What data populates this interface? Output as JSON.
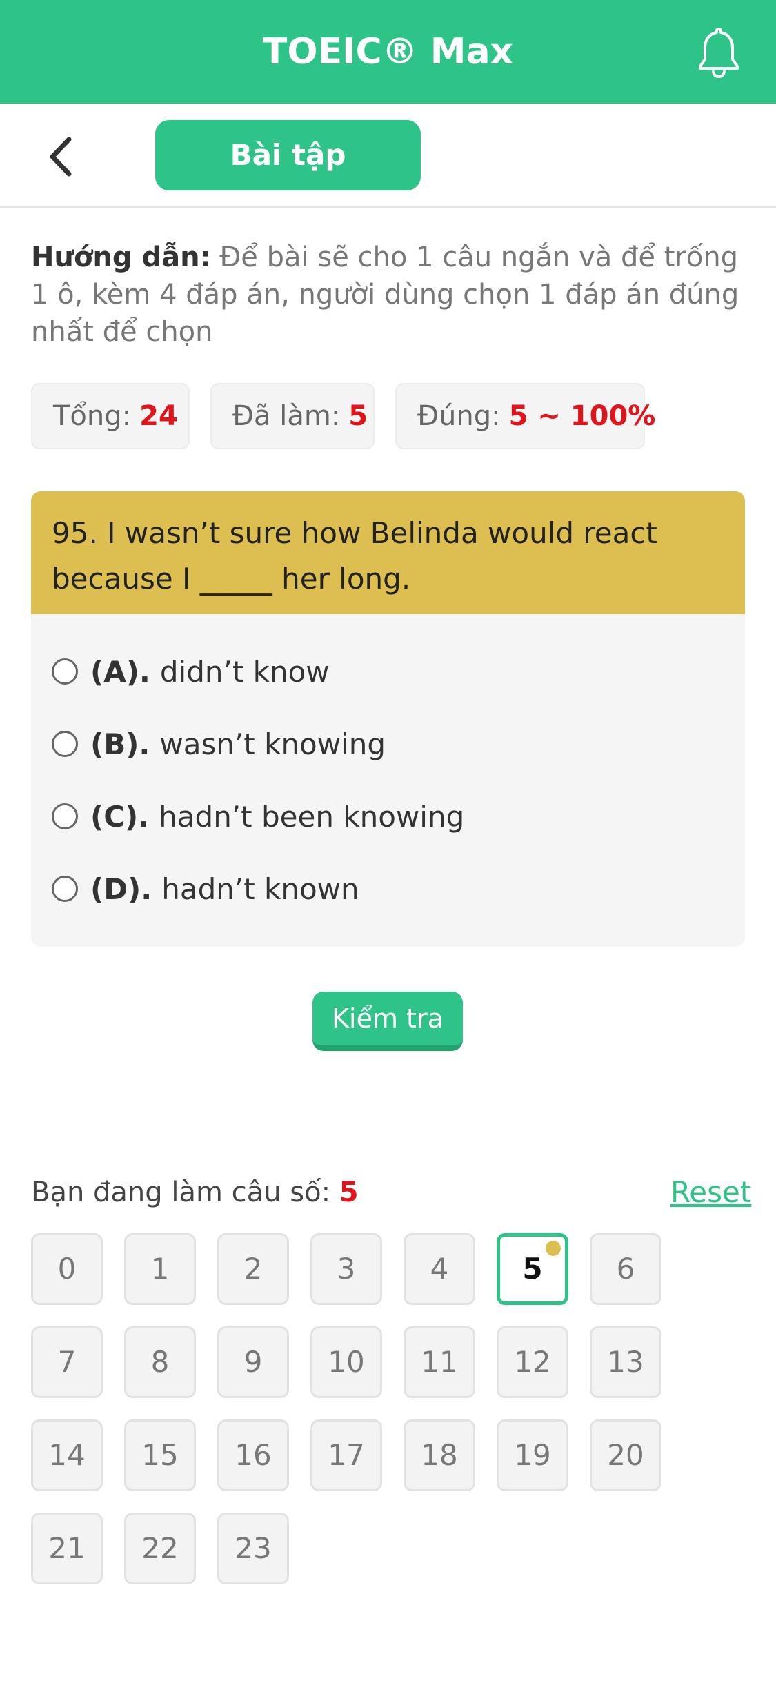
{
  "header": {
    "title": "TOEIC® Max",
    "bell_icon": "bell-icon"
  },
  "subheader": {
    "back_icon": "chevron-left-icon",
    "tab_label": "Bài tập"
  },
  "instructions": {
    "label": "Hướng dẫn:",
    "text": "Để bài sẽ cho 1 câu ngắn và để trống 1 ô, kèm 4 đáp án, người dùng chọn 1 đáp án đúng nhất để chọn"
  },
  "stats": {
    "total_label": "Tổng:",
    "total_value": "24",
    "done_label": "Đã làm:",
    "done_value": "5",
    "correct_label": "Đúng:",
    "correct_value": "5 ~ 100%"
  },
  "question": {
    "text": "95. I wasn’t sure how Belinda would react because I _____ her long.",
    "options": [
      {
        "key": "(A).",
        "text": "didn’t know"
      },
      {
        "key": "(B).",
        "text": "wasn’t knowing"
      },
      {
        "key": "(C).",
        "text": "hadn’t been knowing"
      },
      {
        "key": "(D).",
        "text": "hadn’t known"
      }
    ]
  },
  "check_button": "Kiểm tra",
  "progress": {
    "label": "Bạn đang làm câu số:",
    "current": "5",
    "reset_label": "Reset"
  },
  "question_numbers": [
    "0",
    "1",
    "2",
    "3",
    "4",
    "5",
    "6",
    "7",
    "8",
    "9",
    "10",
    "11",
    "12",
    "13",
    "14",
    "15",
    "16",
    "17",
    "18",
    "19",
    "20",
    "21",
    "22",
    "23"
  ],
  "colors": {
    "primary": "#2ec487",
    "question_header": "#dcbf50",
    "highlight_red": "#e0141b"
  }
}
